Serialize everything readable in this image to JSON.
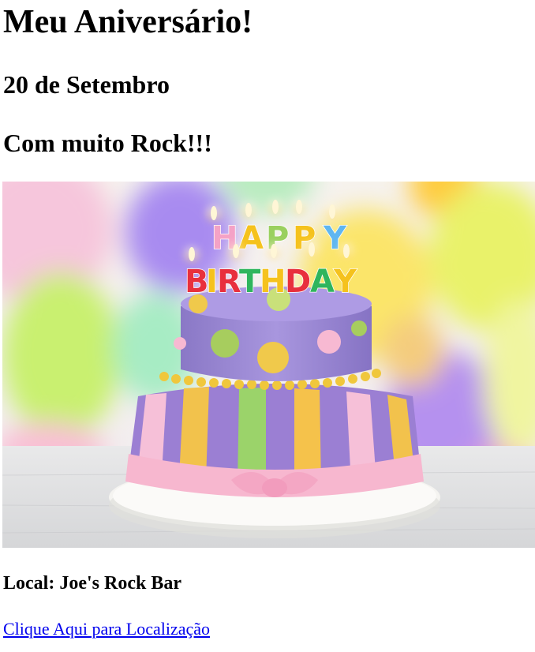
{
  "page": {
    "title": "Meu Aniversário!",
    "date": "20 de Setembro",
    "tagline": "Com muito Rock!!!",
    "location": "Local: Joe's Rock Bar",
    "location_link": "Clique Aqui para Localização"
  },
  "image": {
    "cake_letters": [
      "H",
      "A",
      "P",
      "P",
      "Y",
      "B",
      "I",
      "R",
      "T",
      "H",
      "D",
      "A",
      "Y"
    ]
  },
  "colors": {
    "link": "#0000ee",
    "text": "#000000"
  }
}
